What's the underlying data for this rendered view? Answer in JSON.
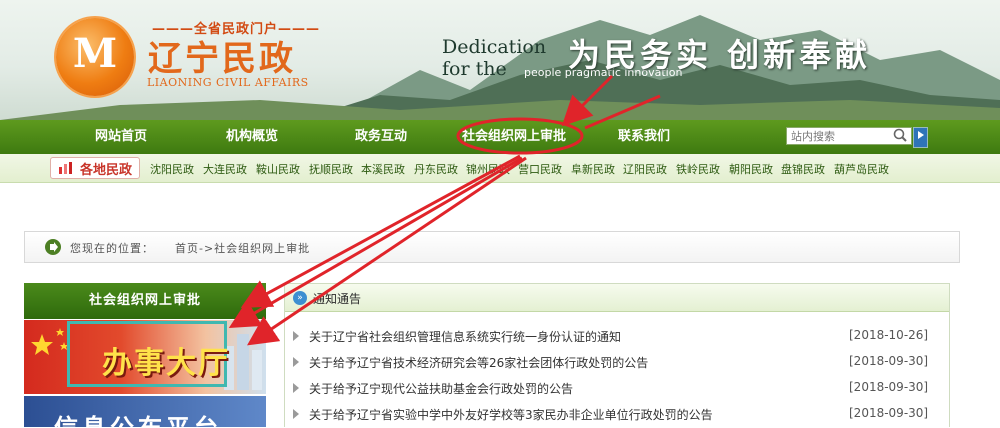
{
  "header": {
    "portal_text": "全省民政门户",
    "logo_glyph": "M",
    "logo_cn": "辽宁民政",
    "logo_en": "LIAONING CIVIL AFFAIRS",
    "slogan_line1": "Dedication",
    "slogan_line2": "for the",
    "slogan_small": "people pragmatic innovation",
    "slogan_cn": "为民务实 创新奉献"
  },
  "nav": {
    "items": [
      {
        "label": "网站首页"
      },
      {
        "label": "机构概览"
      },
      {
        "label": "政务互动"
      },
      {
        "label": "社会组织网上审批"
      },
      {
        "label": "联系我们"
      }
    ],
    "search_placeholder": "站内搜索"
  },
  "regions": {
    "label": "各地民政",
    "cities": [
      "沈阳民政",
      "大连民政",
      "鞍山民政",
      "抚顺民政",
      "本溪民政",
      "丹东民政",
      "锦州民政",
      "营口民政",
      "阜新民政",
      "辽阳民政",
      "铁岭民政",
      "朝阳民政",
      "盘锦民政",
      "葫芦岛民政"
    ]
  },
  "breadcrumb": {
    "label": "您现在的位置：",
    "path": "首页->社会组织网上审批"
  },
  "sidebar": {
    "title": "社会组织网上审批",
    "hall_label": "办事大厅",
    "info_label": "信息公布平台"
  },
  "notices": {
    "title": "通知通告",
    "items": [
      {
        "title": "关于辽宁省社会组织管理信息系统实行统一身份认证的通知",
        "date": "[2018-10-26]"
      },
      {
        "title": "关于给予辽宁省技术经济研究会等26家社会团体行政处罚的公告",
        "date": "[2018-09-30]"
      },
      {
        "title": "关于给予辽宁现代公益扶助基金会行政处罚的公告",
        "date": "[2018-09-30]"
      },
      {
        "title": "关于给予辽宁省实验中学中外友好学校等3家民办非企业单位行政处罚的公告",
        "date": "[2018-09-30]"
      }
    ]
  },
  "annotation_color": "#e0242a"
}
